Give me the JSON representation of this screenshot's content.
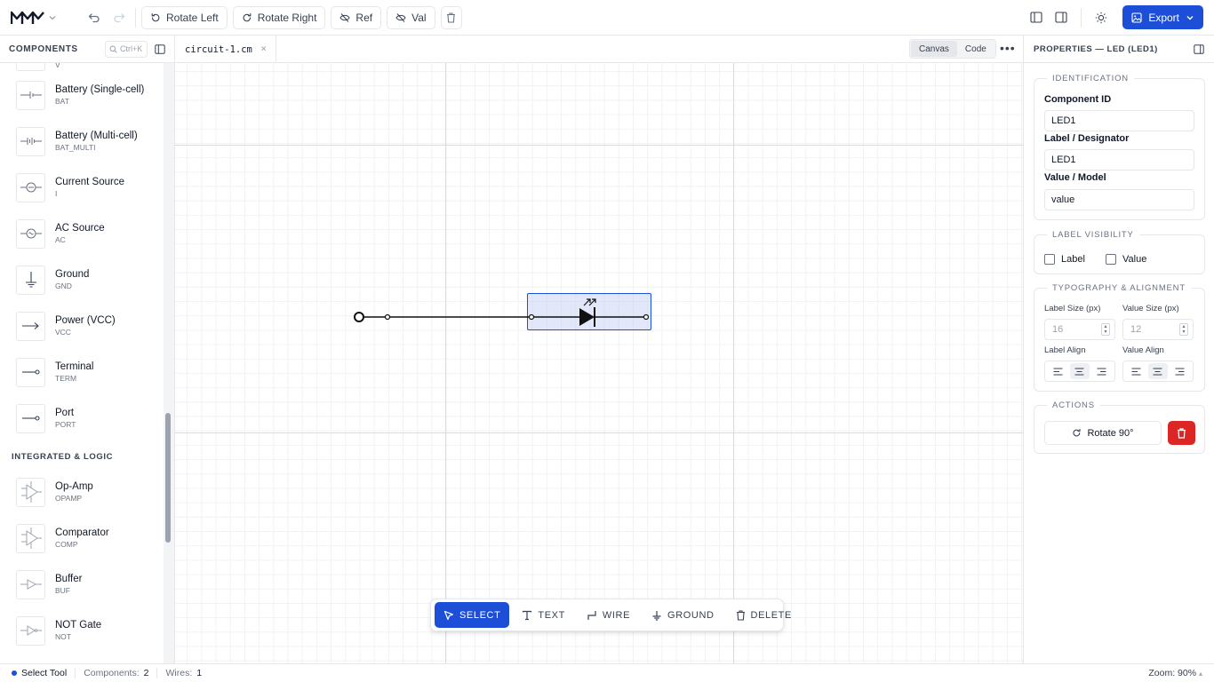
{
  "toolbar": {
    "rotate_left": "Rotate Left",
    "rotate_right": "Rotate Right",
    "ref": "Ref",
    "val": "Val",
    "export": "Export"
  },
  "sidebar": {
    "title": "COMPONENTS",
    "search_hint": "Ctrl+K",
    "top_partial_code": "V",
    "items": [
      {
        "name": "Battery (Single-cell)",
        "code": "BAT",
        "icon": "battery-single-symbol"
      },
      {
        "name": "Battery (Multi-cell)",
        "code": "BAT_MULTI",
        "icon": "battery-multi-symbol"
      },
      {
        "name": "Current Source",
        "code": "I",
        "icon": "current-source-symbol"
      },
      {
        "name": "AC Source",
        "code": "AC",
        "icon": "ac-source-symbol"
      },
      {
        "name": "Ground",
        "code": "GND",
        "icon": "ground-symbol"
      },
      {
        "name": "Power (VCC)",
        "code": "VCC",
        "icon": "power-arrow-symbol"
      },
      {
        "name": "Terminal",
        "code": "TERM",
        "icon": "terminal-symbol"
      },
      {
        "name": "Port",
        "code": "PORT",
        "icon": "port-symbol"
      }
    ],
    "group2_title": "INTEGRATED & LOGIC",
    "items2": [
      {
        "name": "Op-Amp",
        "code": "OPAMP",
        "icon": "opamp-symbol"
      },
      {
        "name": "Comparator",
        "code": "COMP",
        "icon": "comparator-symbol"
      },
      {
        "name": "Buffer",
        "code": "BUF",
        "icon": "buffer-symbol"
      },
      {
        "name": "NOT Gate",
        "code": "NOT",
        "icon": "not-gate-symbol"
      }
    ]
  },
  "editor": {
    "tab_name": "circuit-1.cm",
    "tab_close": "×",
    "view_canvas": "Canvas",
    "view_code": "Code",
    "more": "•••"
  },
  "tools": {
    "select": "SELECT",
    "text": "TEXT",
    "wire": "WIRE",
    "ground": "GROUND",
    "delete": "DELETE"
  },
  "properties": {
    "title": "PROPERTIES — LED (LED1)",
    "identification": "IDENTIFICATION",
    "component_id_label": "Component ID",
    "component_id": "LED1",
    "designator_label": "Label / Designator",
    "designator": "LED1",
    "value_label": "Value / Model",
    "value": "value",
    "label_visibility": "LABEL VISIBILITY",
    "show_label": "Label",
    "show_value": "Value",
    "typography": "TYPOGRAPHY & ALIGNMENT",
    "label_size_label": "Label Size (px)",
    "label_size": "16",
    "value_size_label": "Value Size (px)",
    "value_size": "12",
    "label_align_label": "Label Align",
    "value_align_label": "Value Align",
    "actions": "ACTIONS",
    "rotate": "Rotate 90°"
  },
  "status": {
    "tool": "Select Tool",
    "components_label": "Components:",
    "components": "2",
    "wires_label": "Wires:",
    "wires": "1",
    "zoom": "Zoom: 90%"
  },
  "colors": {
    "accent": "#1d4ed8",
    "danger": "#dc2626",
    "selection_fill": "#bfcdf5"
  }
}
